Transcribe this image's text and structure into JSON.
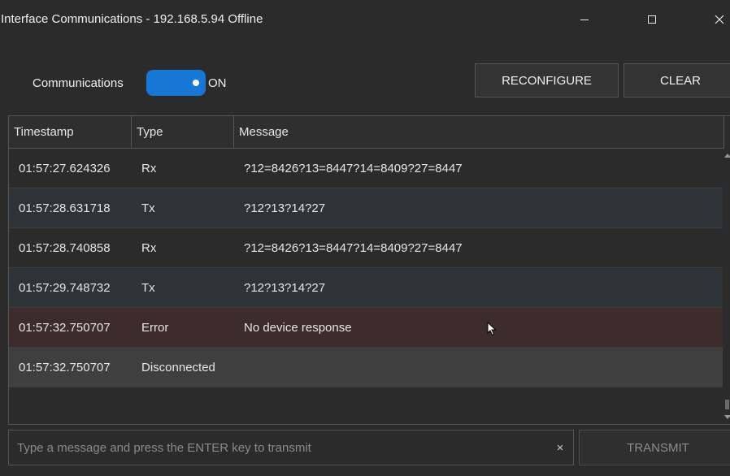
{
  "window": {
    "title": "Interface Communications - 192.168.5.94 Offline",
    "controls": {
      "minimize": "minimize-icon",
      "maximize": "maximize-icon",
      "close": "close-icon"
    }
  },
  "communications": {
    "label": "Communications",
    "state": "ON",
    "enabled": true,
    "toggle_color": "#1677d6"
  },
  "toolbar": {
    "reconfigure_label": "RECONFIGURE",
    "clear_label": "CLEAR"
  },
  "table": {
    "columns": [
      "Timestamp",
      "Type",
      "Message"
    ],
    "rows": [
      {
        "timestamp": "01:57:27.624326",
        "type": "Rx",
        "message": "?12=8426?13=8447?14=8409?27=8447"
      },
      {
        "timestamp": "01:57:28.631718",
        "type": "Tx",
        "message": "?12?13?14?27"
      },
      {
        "timestamp": "01:57:28.740858",
        "type": "Rx",
        "message": "?12=8426?13=8447?14=8409?27=8447"
      },
      {
        "timestamp": "01:57:29.748732",
        "type": "Tx",
        "message": "?12?13?14?27"
      },
      {
        "timestamp": "01:57:32.750707",
        "type": "Error",
        "message": "No device response"
      },
      {
        "timestamp": "01:57:32.750707",
        "type": "Disconnected",
        "message": ""
      }
    ]
  },
  "input": {
    "placeholder": "Type a message and press the ENTER key to transmit",
    "value": "",
    "clear_icon": "×"
  },
  "transmit": {
    "label": "TRANSMIT",
    "enabled": false
  },
  "colors": {
    "background": "#2b2b2b",
    "rx_row": "#2b2b2b",
    "tx_row": "#2e3338",
    "error_row": "#3e2c2c",
    "disconnected_row": "#3f3f3f"
  }
}
